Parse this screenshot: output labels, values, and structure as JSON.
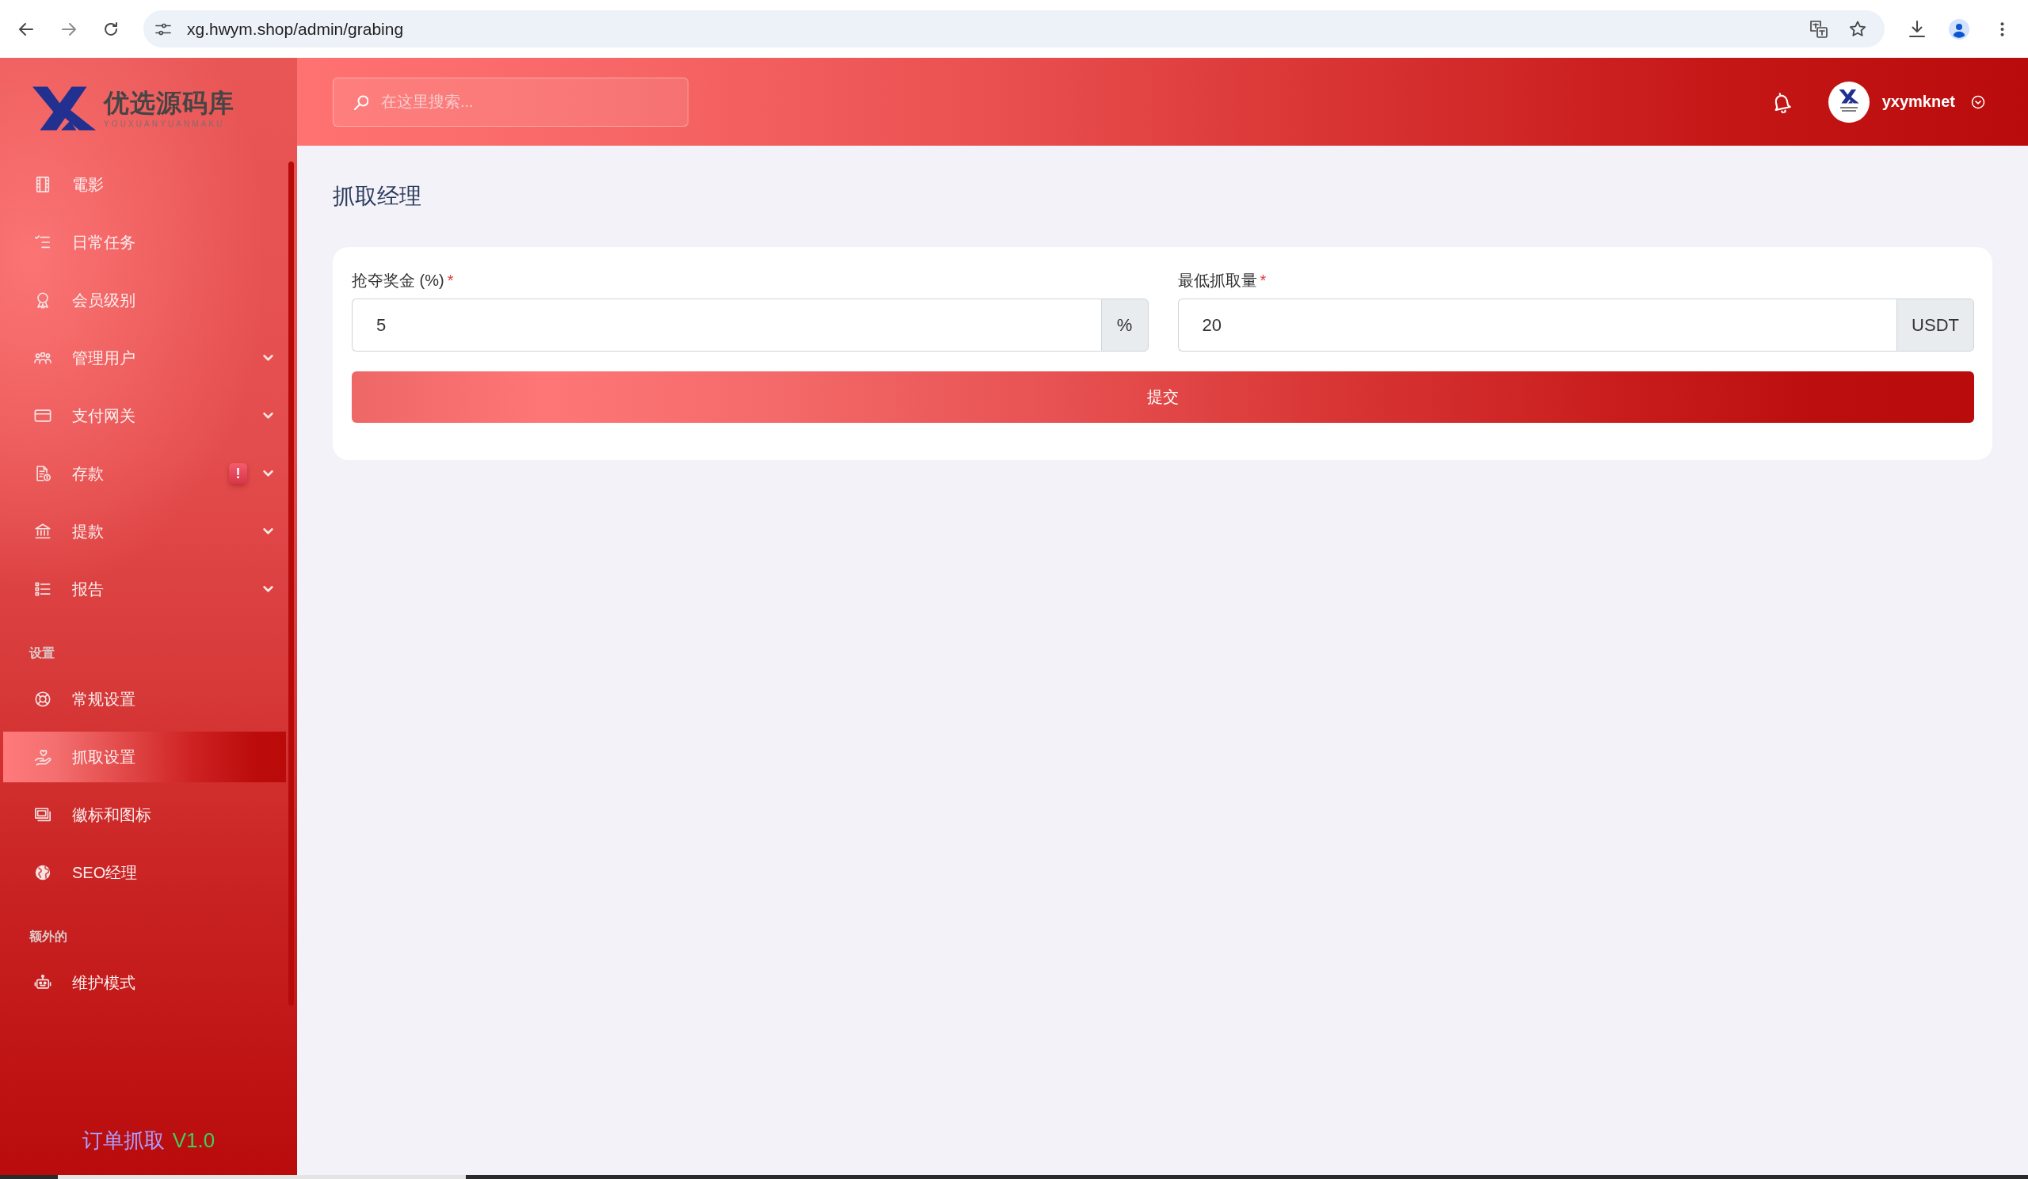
{
  "browser": {
    "url": "xg.hwym.shop/admin/grabing"
  },
  "sidebar": {
    "logo": {
      "title": "优选源码库",
      "subtitle": "YOUXUANYUANMAKU"
    },
    "sections": [
      {
        "items": [
          {
            "label": "電影",
            "kind": "link",
            "selected": false
          },
          {
            "label": "日常任务",
            "kind": "link",
            "selected": false
          },
          {
            "label": "会员级别",
            "kind": "link",
            "selected": false
          },
          {
            "label": "管理用户",
            "kind": "menu",
            "selected": false,
            "expanded": false
          },
          {
            "label": "支付网关",
            "kind": "menu",
            "selected": false,
            "expanded": false
          },
          {
            "label": "存款",
            "kind": "menu",
            "selected": false,
            "expanded": false,
            "badge": "!"
          },
          {
            "label": "提款",
            "kind": "menu",
            "selected": false,
            "expanded": false
          },
          {
            "label": "报告",
            "kind": "menu",
            "selected": false,
            "expanded": false
          }
        ]
      },
      {
        "heading": "设置",
        "items": [
          {
            "label": "常规设置",
            "kind": "link",
            "selected": false
          },
          {
            "label": "抓取设置",
            "kind": "link",
            "selected": true
          },
          {
            "label": "徽标和图标",
            "kind": "link",
            "selected": false
          },
          {
            "label": "SEO经理",
            "kind": "link",
            "selected": false
          }
        ]
      },
      {
        "heading": "额外的",
        "items": [
          {
            "label": "维护模式",
            "kind": "link",
            "selected": false
          }
        ]
      }
    ],
    "footer": {
      "name": "订单抓取",
      "version": "V1.0"
    }
  },
  "header": {
    "search": {
      "placeholder": "在这里搜索..."
    },
    "user": {
      "name": "yxymknet"
    }
  },
  "page": {
    "title": "抓取经理"
  },
  "form": {
    "fields": [
      {
        "label": "抢夺奖金 (%)",
        "required_mark": "*",
        "value": "5",
        "unit": "%"
      },
      {
        "label": "最低抓取量",
        "required_mark": "*",
        "value": "20",
        "unit": "USDT"
      }
    ],
    "submit": "提交"
  }
}
